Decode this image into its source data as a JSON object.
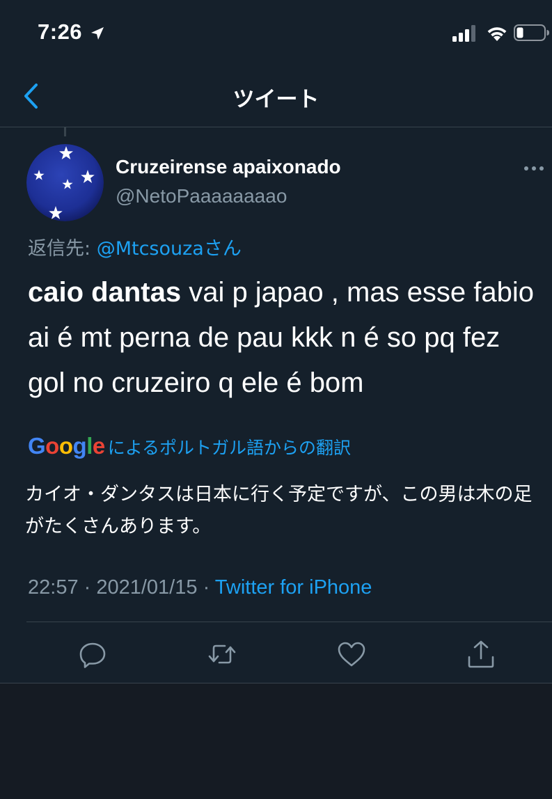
{
  "status_bar": {
    "time": "7:26"
  },
  "nav": {
    "title": "ツイート"
  },
  "tweet": {
    "display_name": "Cruzeirense apaixonado",
    "handle": "@NetoPaaaaaaaao",
    "reply_prefix": "返信先: ",
    "reply_mention": "@Mtcsouzaさん",
    "text_bold": "caio dantas",
    "text_rest": " vai p japao , mas esse fabio ai é mt perna de pau kkk n é so pq fez gol no cruzeiro q ele é bom",
    "translation": {
      "google_letters": [
        "G",
        "o",
        "o",
        "g",
        "l",
        "e"
      ],
      "label": "によるポルトガル語からの翻訳",
      "text": "カイオ・ダンタスは日本に行く予定ですが、この男は木の足がたくさんあります。"
    },
    "meta": {
      "time": "22:57",
      "separator": " · ",
      "date": "2021/01/15",
      "source": "Twitter for iPhone"
    }
  },
  "colors": {
    "background": "#15202b",
    "accent": "#1da1f2",
    "secondary_text": "#8899a6",
    "divider": "#38444d"
  },
  "icons": {
    "back": "chevron-left-icon",
    "more": "more-horizontal-icon",
    "reply": "comment-icon",
    "retweet": "retweet-icon",
    "like": "heart-icon",
    "share": "share-icon"
  }
}
